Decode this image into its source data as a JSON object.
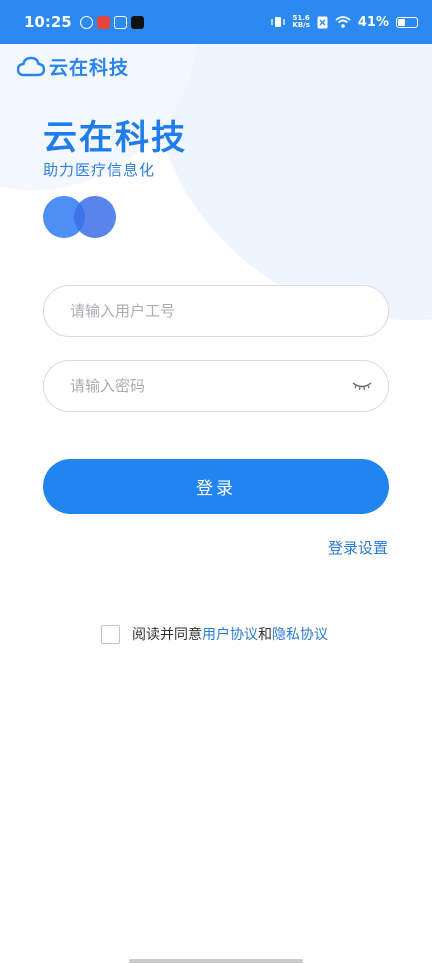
{
  "status_bar": {
    "time": "10:25",
    "net_speed_value": "51.6",
    "net_speed_unit": "KB/s",
    "battery_percent": "41%",
    "battery_level": 0.41,
    "bg_color": "#2c89f2",
    "icons": [
      "vibrate-icon",
      "network-speed-icon",
      "sim-off-icon",
      "wifi-icon",
      "battery-icon"
    ]
  },
  "brand": {
    "top_name": "云在科技",
    "title": "云在科技",
    "subtitle": "助力医疗信息化",
    "accent_color": "#2185f0"
  },
  "form": {
    "username_placeholder": "请输入用户工号",
    "username_value": "",
    "password_placeholder": "请输入密码",
    "password_value": "",
    "login_label": "登录",
    "settings_label": "登录设置"
  },
  "agreement": {
    "prefix": "阅读并同意",
    "user_agreement": "用户协议",
    "conjunction": "和",
    "privacy_agreement": "隐私协议",
    "checked": false
  }
}
